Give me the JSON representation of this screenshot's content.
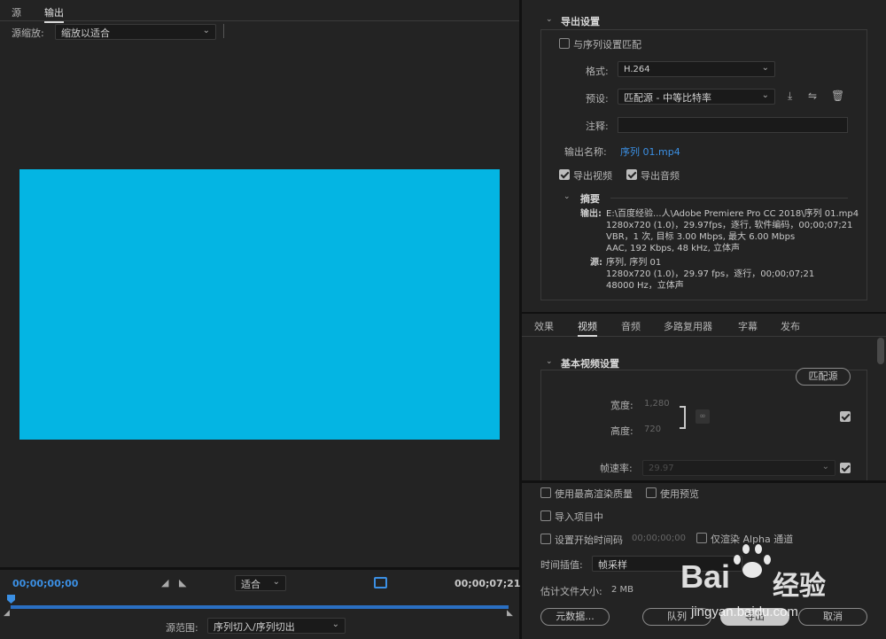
{
  "preview": {
    "tabs": [
      {
        "label": "源"
      },
      {
        "label": "输出"
      }
    ],
    "zoom_label": "源缩放:",
    "zoom_value": "缩放以适合",
    "frame_color": "#04b5e3",
    "timecode_start": "00;00;00;00",
    "timecode_end": "00;00;07;21",
    "fit_value": "适合",
    "source_range_label": "源范围:",
    "source_range_value": "序列切入/序列切出",
    "progress_fraction": 1.0
  },
  "export_settings": {
    "title": "导出设置",
    "match_sequence_label": "与序列设置匹配",
    "match_sequence_checked": false,
    "format_label": "格式:",
    "format_value": "H.264",
    "preset_label": "预设:",
    "preset_value": "匹配源 - 中等比特率",
    "comment_label": "注释:",
    "comment_value": "",
    "output_name_label": "输出名称:",
    "output_name_value": "序列 01.mp4",
    "export_video_label": "导出视频",
    "export_video_checked": true,
    "export_audio_label": "导出音频",
    "export_audio_checked": true,
    "summary_title": "摘要",
    "summary_output_label": "输出:",
    "summary_output_lines": [
      "E:\\百度经验...人\\Adobe Premiere Pro CC 2018\\序列 01.mp4",
      "1280x720 (1.0)，29.97fps，逐行, 软件编码，00;00;07;21",
      "VBR，1 次, 目标 3.00 Mbps, 最大 6.00 Mbps",
      "AAC, 192 Kbps, 48  kHz, 立体声"
    ],
    "summary_source_label": "源:",
    "summary_source_lines": [
      "序列, 序列 01",
      "1280x720 (1.0)，29.97 fps，逐行，00;00;07;21",
      "48000 Hz，立体声"
    ]
  },
  "settings_tabs": [
    {
      "label": "效果"
    },
    {
      "label": "视频"
    },
    {
      "label": "音频"
    },
    {
      "label": "多路复用器"
    },
    {
      "label": "字幕"
    },
    {
      "label": "发布"
    }
  ],
  "video": {
    "section_title": "基本视频设置",
    "match_source_button": "匹配源",
    "width_label": "宽度:",
    "width_value": "1,280",
    "height_label": "高度:",
    "height_value": "720",
    "framerate_label": "帧速率:",
    "framerate_value": "29.97"
  },
  "bottom": {
    "max_render_label": "使用最高渲染质量",
    "use_preview_label": "使用预览",
    "import_project_label": "导入项目中",
    "set_start_tc_label": "设置开始时间码",
    "start_tc_value": "00;00;00;00",
    "render_alpha_label": "仅渲染 Alpha 通道",
    "interp_label": "时间插值:",
    "interp_value": "帧采样",
    "filesize_label": "估计文件大小:",
    "filesize_value": "2 MB",
    "metadata_button": "元数据...",
    "queue_button": "队列",
    "export_button": "导出",
    "cancel_button": "取消"
  },
  "watermark": {
    "brand": "Bai",
    "brand2": "经验",
    "url": "jingyan.baidu.com"
  }
}
